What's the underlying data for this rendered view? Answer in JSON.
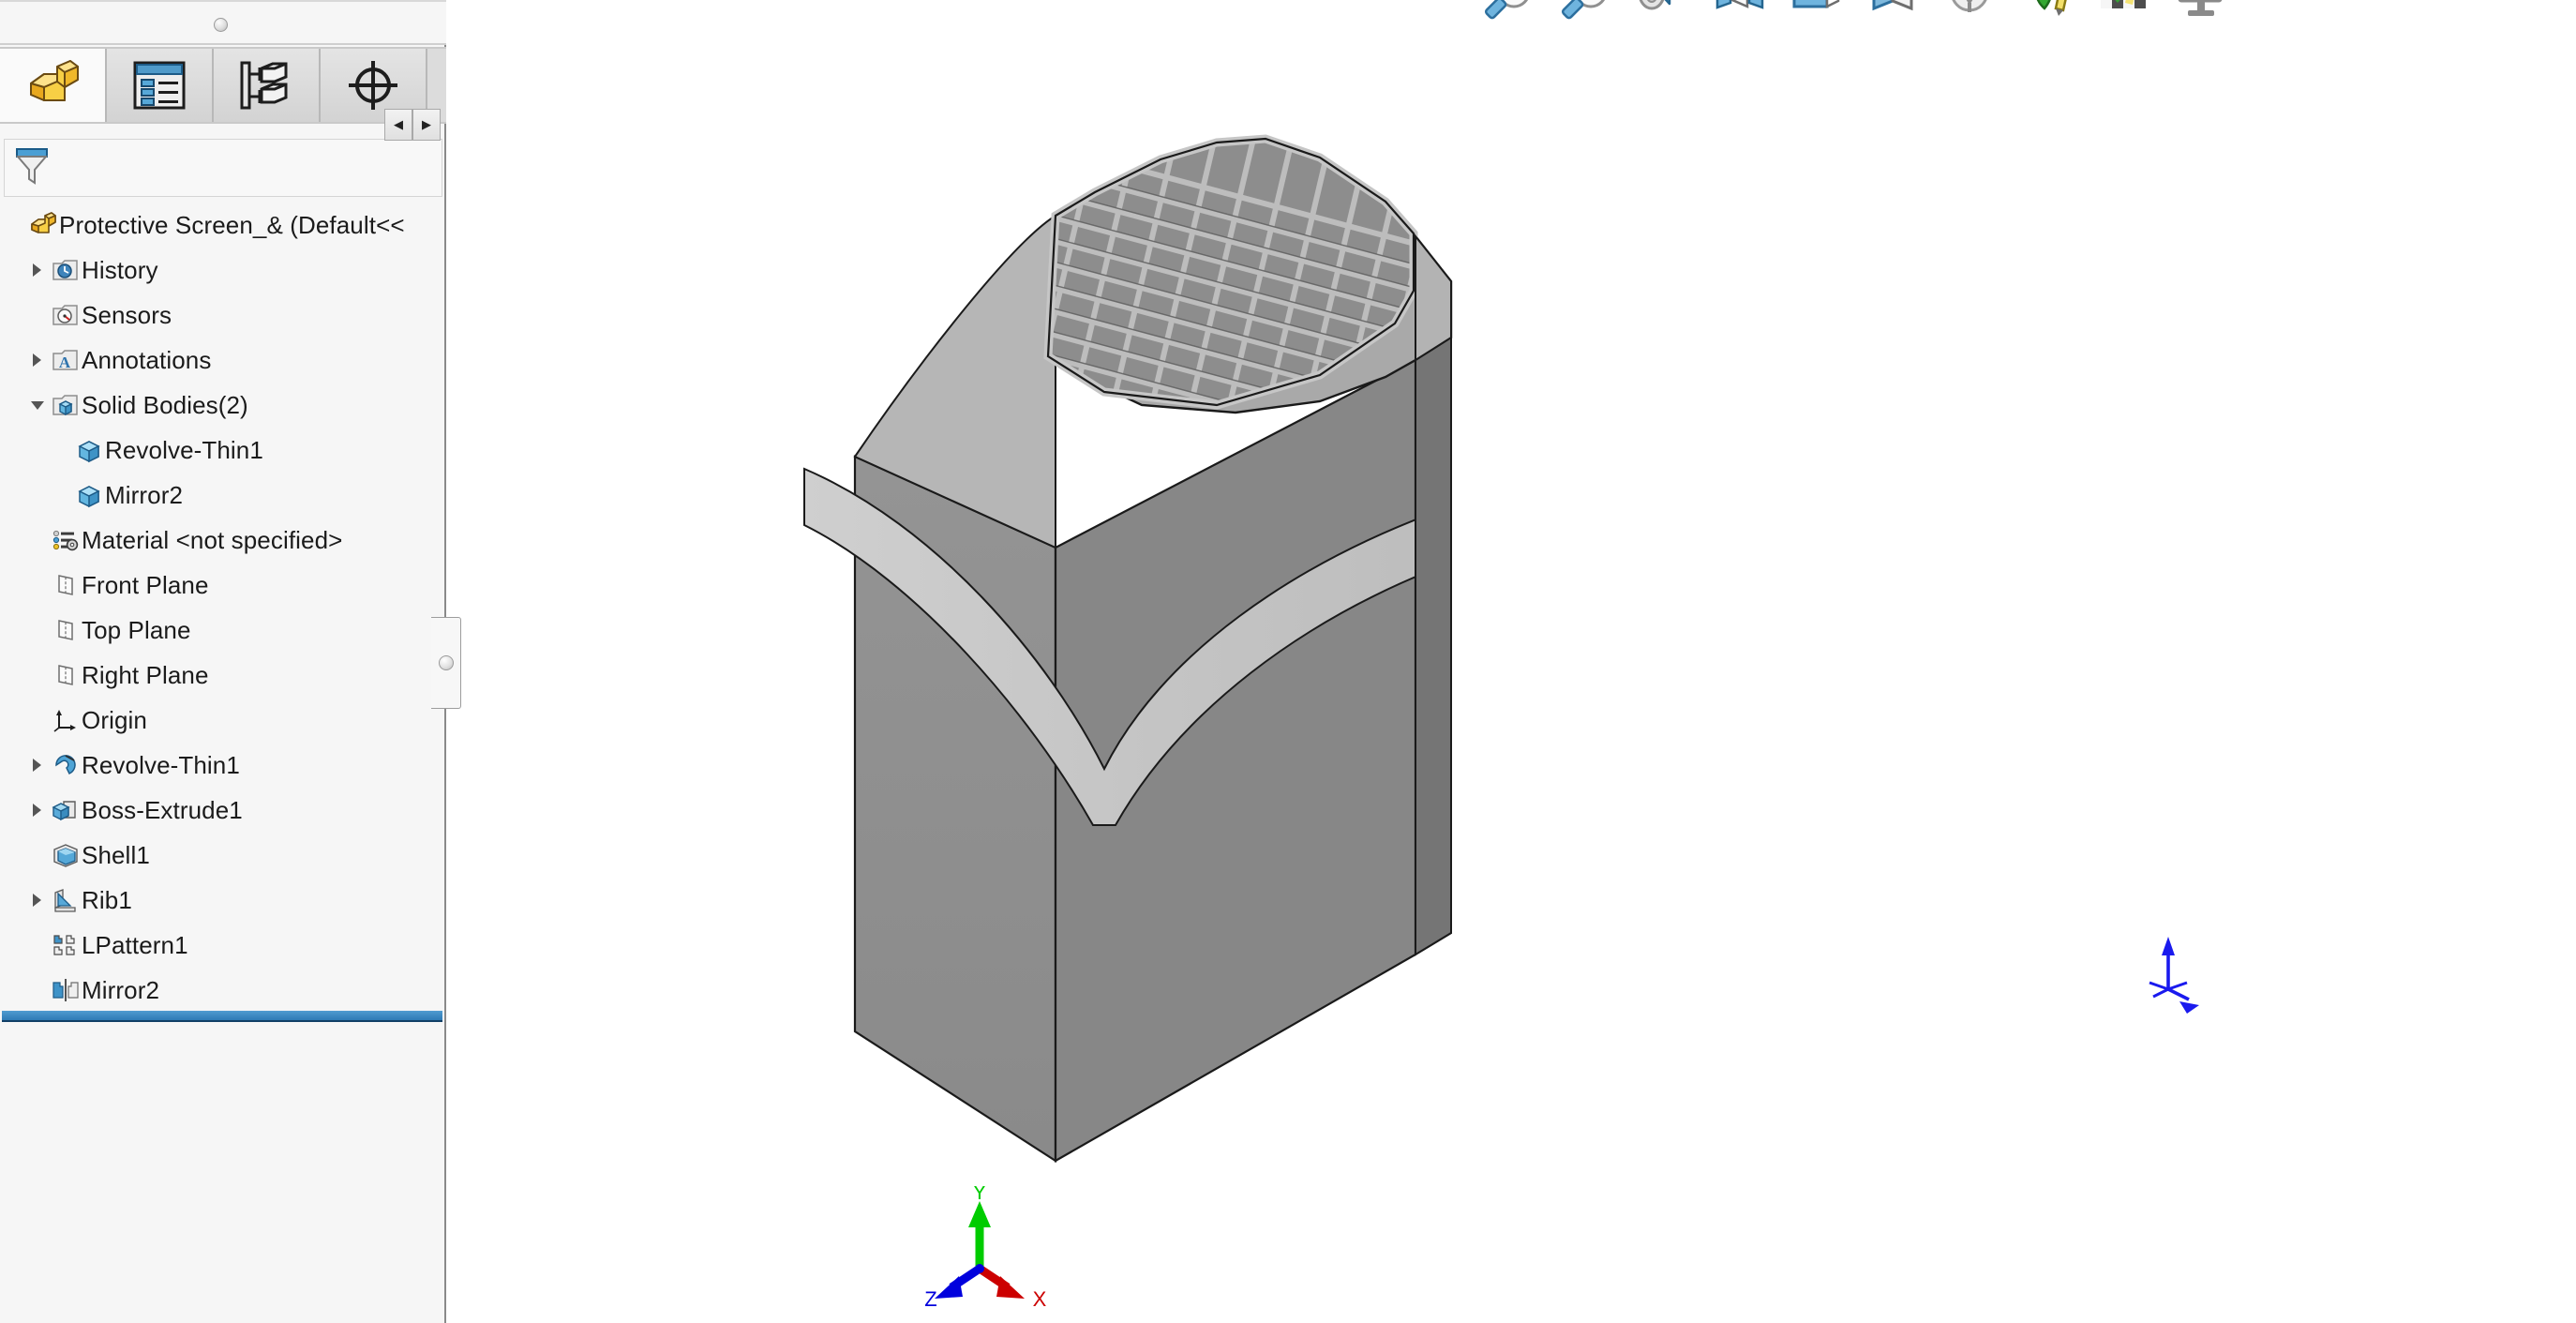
{
  "app": {
    "document_title": "Protective Screen_&  (Default<<"
  },
  "panel": {
    "tabs": [
      {
        "name": "feature-manager",
        "icon": "yellow-part-icon",
        "active": true
      },
      {
        "name": "property-manager",
        "icon": "property-list-icon",
        "active": false
      },
      {
        "name": "configuration-manager",
        "icon": "configuration-tree-icon",
        "active": false
      },
      {
        "name": "dimxpert-manager",
        "icon": "dimxpert-crosshair-icon",
        "active": false
      }
    ],
    "scrollers": {
      "left_label": "◀",
      "right_label": "▶"
    },
    "filter": {
      "icon": "filter-funnel-icon",
      "placeholder": ""
    }
  },
  "tree": {
    "root": {
      "label": "Protective Screen_&  (Default<<",
      "icon": "part-document-icon",
      "indent": 0,
      "toggle": "none"
    },
    "items": [
      {
        "label": "History",
        "icon": "history-folder-icon",
        "indent": 1,
        "toggle": "collapsed"
      },
      {
        "label": "Sensors",
        "icon": "sensors-folder-icon",
        "indent": 1,
        "toggle": "none"
      },
      {
        "label": "Annotations",
        "icon": "annotations-folder-icon",
        "indent": 1,
        "toggle": "collapsed"
      },
      {
        "label": "Solid Bodies(2)",
        "icon": "solid-bodies-folder-icon",
        "indent": 1,
        "toggle": "expanded"
      },
      {
        "label": "Revolve-Thin1",
        "icon": "solid-body-icon",
        "indent": 2,
        "toggle": "none"
      },
      {
        "label": "Mirror2",
        "icon": "solid-body-icon",
        "indent": 2,
        "toggle": "none"
      },
      {
        "label": "Material <not specified>",
        "icon": "material-icon",
        "indent": 1,
        "toggle": "none"
      },
      {
        "label": "Front Plane",
        "icon": "plane-icon",
        "indent": 1,
        "toggle": "none"
      },
      {
        "label": "Top Plane",
        "icon": "plane-icon",
        "indent": 1,
        "toggle": "none"
      },
      {
        "label": "Right Plane",
        "icon": "plane-icon",
        "indent": 1,
        "toggle": "none"
      },
      {
        "label": "Origin",
        "icon": "origin-axes-icon",
        "indent": 1,
        "toggle": "none"
      },
      {
        "label": "Revolve-Thin1",
        "icon": "revolve-thin-feature-icon",
        "indent": 1,
        "toggle": "collapsed"
      },
      {
        "label": "Boss-Extrude1",
        "icon": "boss-extrude-feature-icon",
        "indent": 1,
        "toggle": "collapsed"
      },
      {
        "label": "Shell1",
        "icon": "shell-feature-icon",
        "indent": 1,
        "toggle": "none"
      },
      {
        "label": "Rib1",
        "icon": "rib-feature-icon",
        "indent": 1,
        "toggle": "collapsed"
      },
      {
        "label": "LPattern1",
        "icon": "linear-pattern-icon",
        "indent": 1,
        "toggle": "none"
      },
      {
        "label": "Mirror2",
        "icon": "mirror-feature-icon",
        "indent": 1,
        "toggle": "none"
      }
    ],
    "rollback_bar": {
      "name": "rollback-bar"
    }
  },
  "viewport": {
    "heads_up_toolbar": [
      {
        "name": "zoom-to-fit-icon"
      },
      {
        "name": "zoom-to-area-icon"
      },
      {
        "name": "previous-view-icon"
      },
      {
        "name": "section-view-icon"
      },
      {
        "name": "view-orientation-icon"
      },
      {
        "name": "display-style-icon"
      },
      {
        "name": "hide-show-items-icon"
      },
      {
        "name": "edit-appearance-icon"
      },
      {
        "name": "apply-scene-icon"
      },
      {
        "name": "view-settings-icon"
      }
    ],
    "model": {
      "name": "protective-screen-3d-model",
      "colors": {
        "face_light": "#c9c9c9",
        "face_mid": "#9a9a9a",
        "face_dark": "#808080",
        "face_darker": "#6f6f6f",
        "grid_rib": "#b0b0b0",
        "grid_cell": "#8d8d8d",
        "edge": "#1a1a1a"
      }
    },
    "origin_marker": {
      "name": "model-origin-marker",
      "color": "#1a1aee"
    },
    "triad": {
      "name": "reference-triad",
      "axes": [
        {
          "label": "X",
          "color": "#cc0000"
        },
        {
          "label": "Y",
          "color": "#00cc00"
        },
        {
          "label": "Z",
          "color": "#0000dd"
        }
      ]
    }
  }
}
